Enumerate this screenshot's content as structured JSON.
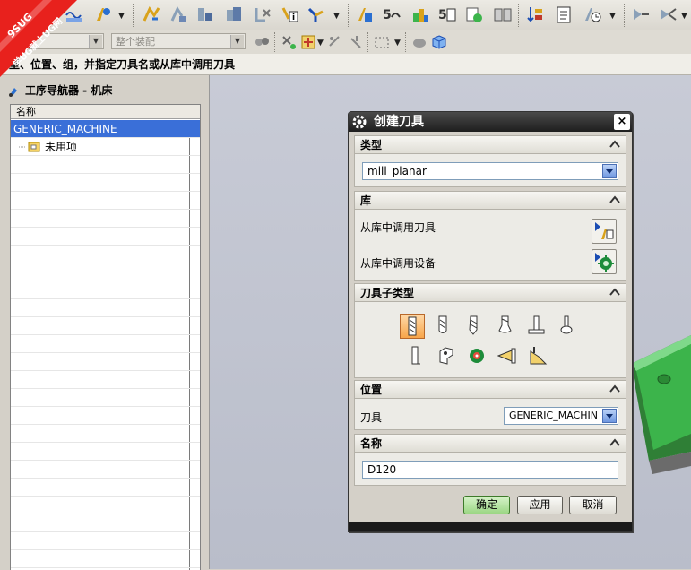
{
  "watermark": {
    "site": "9SUG",
    "slogan": "学UG就上UG网"
  },
  "toolbar2": {
    "combo1": "器",
    "combo2": "整个装配"
  },
  "cue_line": "型、位置、组，并指定刀具名或从库中调用刀具",
  "navigator": {
    "title": "工序导航器 - 机床",
    "column_header": "名称",
    "rows": [
      {
        "label": "GENERIC_MACHINE",
        "selected": true
      },
      {
        "label": "未用项",
        "selected": false
      }
    ]
  },
  "dialog": {
    "title": "创建刀具",
    "close": "×",
    "type_group": {
      "header": "类型",
      "value": "mill_planar"
    },
    "library_group": {
      "header": "库",
      "items": [
        "从库中调用刀具",
        "从库中调用设备"
      ]
    },
    "subtype_group": {
      "header": "刀具子类型"
    },
    "location_group": {
      "header": "位置",
      "tool_label": "刀具",
      "tool_value": "GENERIC_MACHIN"
    },
    "name_group": {
      "header": "名称",
      "value": "D120"
    },
    "buttons": {
      "ok": "确定",
      "apply": "应用",
      "cancel": "取消"
    }
  },
  "colors": {
    "selection": "#3a6fd8",
    "dialog_title": "#1e1e1e",
    "model": "#3cb44b",
    "ok_button": "#9bd684"
  }
}
